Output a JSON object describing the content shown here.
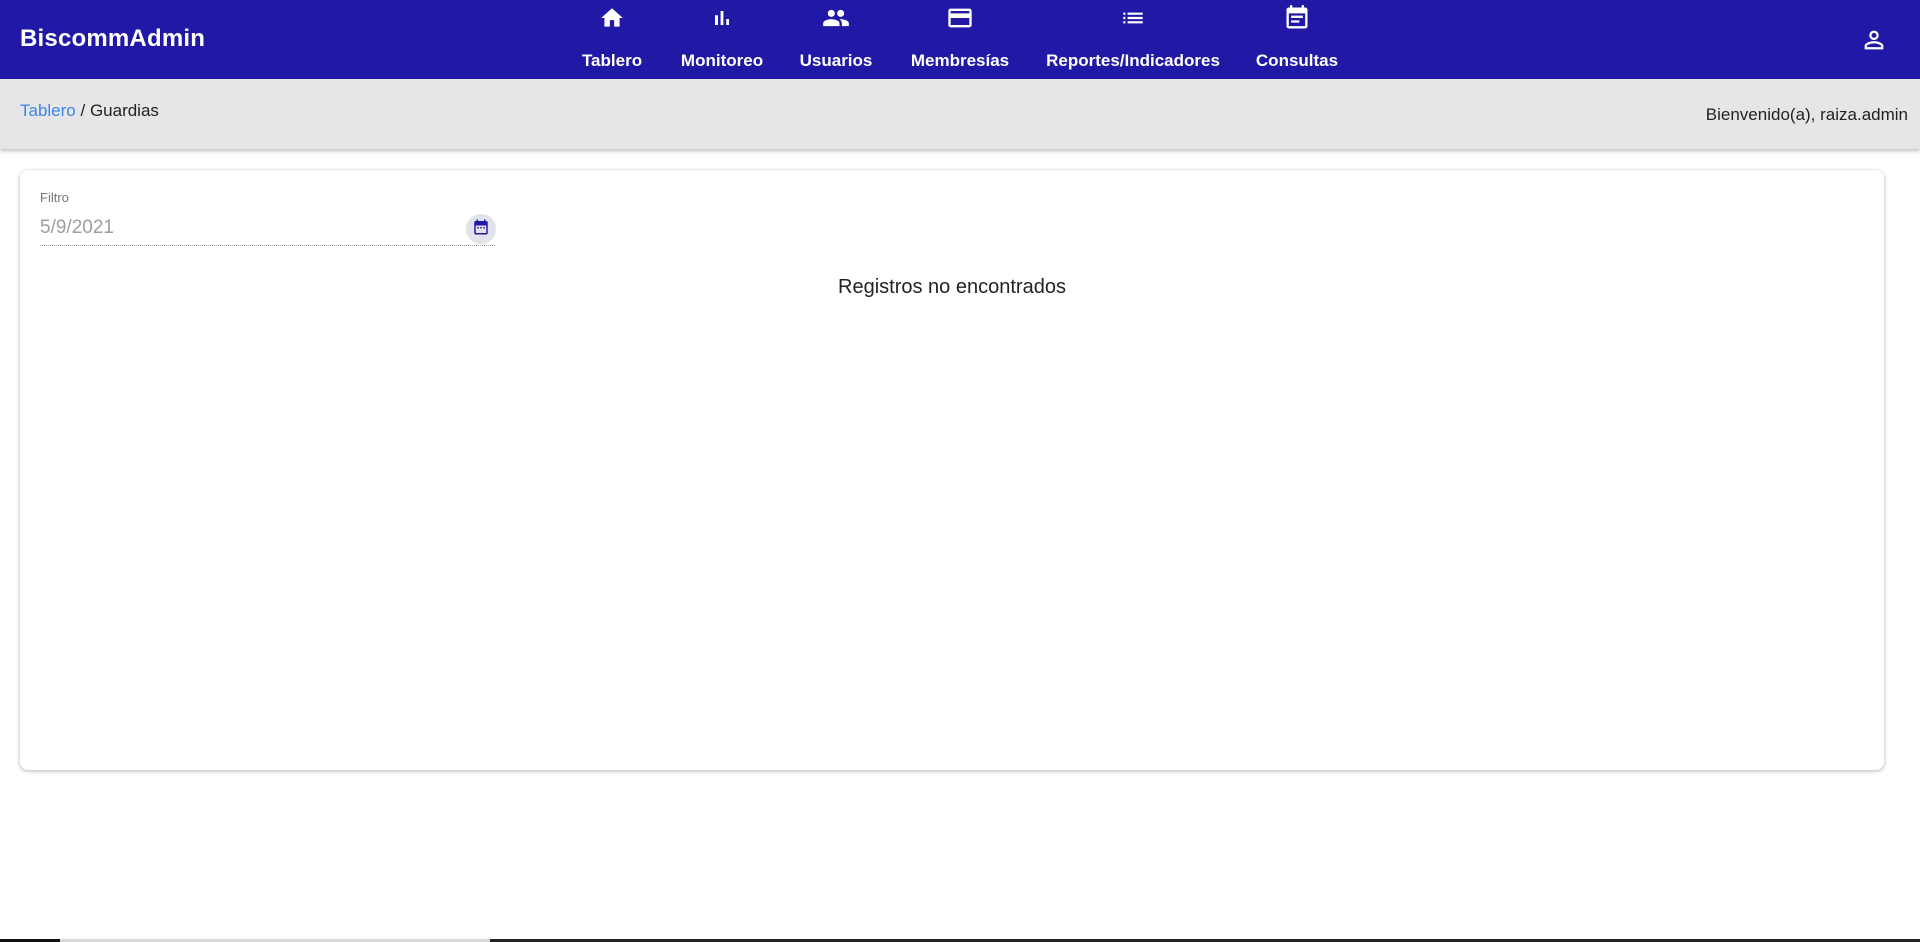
{
  "app": {
    "brand": "BiscommAdmin",
    "accent_color": "#2218a6",
    "link_color": "#3b86e6"
  },
  "nav": {
    "items": [
      {
        "label": "Tablero",
        "icon": "home-icon"
      },
      {
        "label": "Monitoreo",
        "icon": "bar-chart-icon"
      },
      {
        "label": "Usuarios",
        "icon": "people-icon"
      },
      {
        "label": "Membresías",
        "icon": "credit-card-icon"
      },
      {
        "label": "Reportes/Indicadores",
        "icon": "list-icon"
      },
      {
        "label": "Consultas",
        "icon": "event-note-icon"
      }
    ],
    "user_icon": "person-icon"
  },
  "breadcrumb": {
    "link": "Tablero",
    "separator": " / ",
    "current": "Guardias"
  },
  "welcome": "Bienvenido(a), raiza.admin",
  "filter": {
    "label": "Filtro",
    "value": "5/9/2021",
    "calendar_icon": "calendar-icon"
  },
  "empty_message": "Registros no encontrados"
}
